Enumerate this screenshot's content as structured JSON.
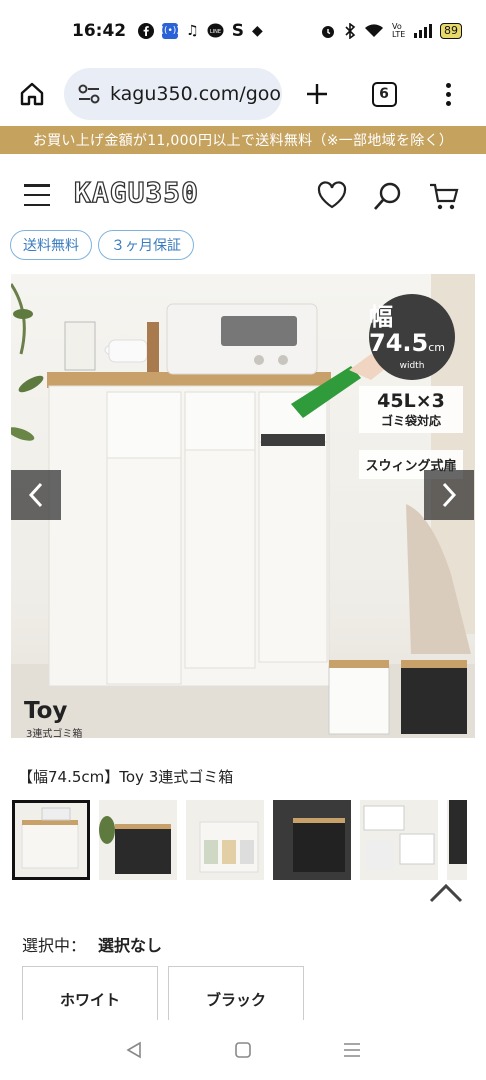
{
  "status_bar": {
    "time": "16:42",
    "left_icons": [
      "facebook-icon",
      "radio-icon",
      "music-icon",
      "line-icon",
      "s-icon",
      "dot-icon"
    ],
    "s_label": "S",
    "battery": "89",
    "network": "Vo LTE"
  },
  "browser": {
    "url": "kagu350.com/goo",
    "tab_count": "6"
  },
  "promo": {
    "text": "お買い上げ金額が11,000円以上で送料無料（※一部地域を除く）"
  },
  "header": {
    "logo": "KAGU350"
  },
  "tags": [
    "送料無料",
    "３ヶ月保証"
  ],
  "hero": {
    "width_number": "幅74.5",
    "width_unit": "cm",
    "width_caption": "width",
    "capacity": "45L×3",
    "capacity_sub": "ゴミ袋対応",
    "swing": "スウィング式扉",
    "brand": "Toy",
    "brand_sub": "3連式ゴミ箱"
  },
  "product": {
    "title": "【幅74.5cm】Toy 3連式ゴミ箱"
  },
  "selection": {
    "label": "選択中：",
    "value": "選択なし",
    "options": [
      "ホワイト",
      "ブラック"
    ]
  },
  "colors": {
    "promo": "#c6a25f",
    "tag_border": "#7fb3df",
    "tag_text": "#3a7cc0"
  }
}
